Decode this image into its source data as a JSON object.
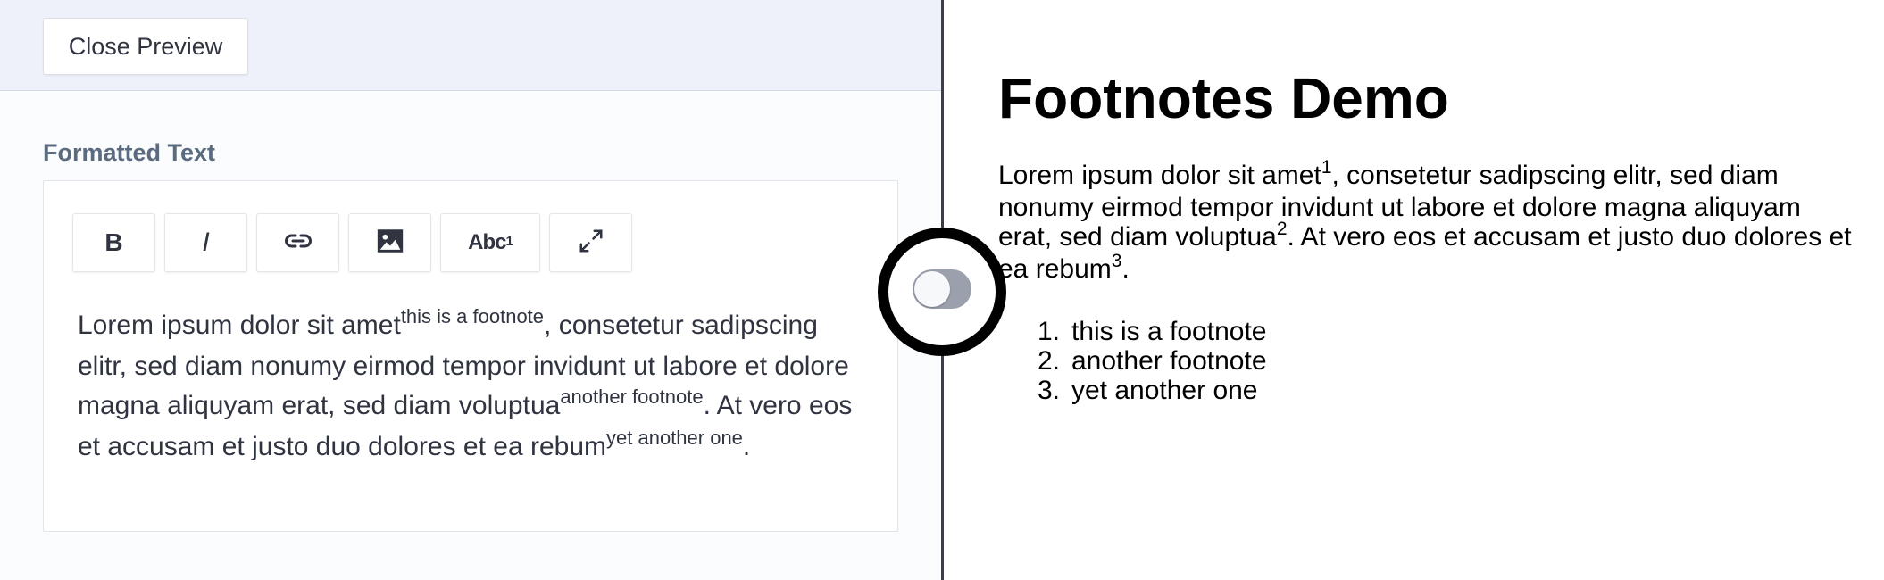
{
  "editor": {
    "close_preview_label": "Close Preview",
    "field_label": "Formatted Text",
    "toolbar": {
      "bold_label": "B",
      "italic_label": "I",
      "link_icon": "link-icon",
      "image_icon": "image-icon",
      "footnote_label": "Abc",
      "footnote_sup": "1",
      "fullscreen_icon": "expand-icon"
    },
    "content": {
      "seg1": "Lorem ipsum dolor sit amet",
      "fn1": "this is a footnote",
      "seg2": ", consetetur sadipscing elitr, sed diam nonumy eirmod tempor invidunt ut labore et dolore magna aliquyam erat, sed diam voluptua",
      "fn2": "another footnote",
      "seg3": ". At vero eos et accusam et justo duo dolores et ea rebum",
      "fn3": "yet another one",
      "seg4": "."
    }
  },
  "toggle": {
    "state": "off"
  },
  "preview": {
    "title": "Footnotes Demo",
    "seg1": "Lorem ipsum dolor sit amet",
    "ref1": "1",
    "seg2": ", consetetur sadipscing elitr, sed diam nonumy eirmod tempor invidunt ut labore et dolore magna aliquyam erat, sed diam voluptua",
    "ref2": "2",
    "seg3": ". At vero eos et accusam et justo duo dolores et ea rebum",
    "ref3": "3",
    "seg4": ".",
    "footnotes": [
      {
        "num": "1.",
        "text": "this is a footnote"
      },
      {
        "num": "2.",
        "text": "another footnote"
      },
      {
        "num": "3.",
        "text": "yet another one"
      }
    ]
  },
  "colors": {
    "top_bar_bg": "#eef1fa",
    "label_color": "#5b6b7f",
    "text_color": "#2f3440",
    "divider": "#3a3f47",
    "toggle_track": "#9aa1ad"
  }
}
